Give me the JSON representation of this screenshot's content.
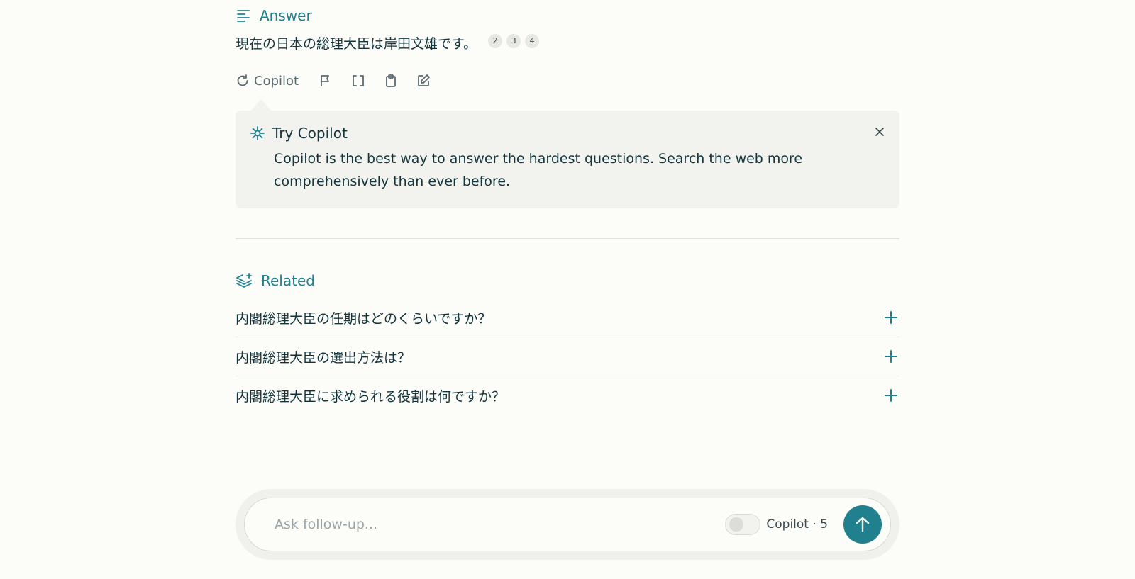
{
  "answer": {
    "heading": "Answer",
    "text": "現在の日本の総理大臣は岸田文雄です。",
    "citations": [
      "2",
      "3",
      "4"
    ]
  },
  "actions": {
    "rewrite_label": "Copilot",
    "icons": [
      "flag-icon",
      "brackets-icon",
      "clipboard-icon",
      "edit-icon"
    ]
  },
  "tip": {
    "title": "Try Copilot",
    "body": "Copilot is the best way to answer the hardest questions. Search the web more comprehensively than ever before."
  },
  "related": {
    "heading": "Related",
    "items": [
      "内閣総理大臣の任期はどのくらいですか？",
      "内閣総理大臣の選出方法は？",
      "内閣総理大臣に求められる役割は何ですか？"
    ]
  },
  "ask": {
    "placeholder": "Ask follow-up...",
    "copilot_label": "Copilot · 5",
    "copilot_enabled": false
  },
  "colors": {
    "accent": "#20808d",
    "text": "#13343b",
    "background": "#fcfcf9"
  }
}
